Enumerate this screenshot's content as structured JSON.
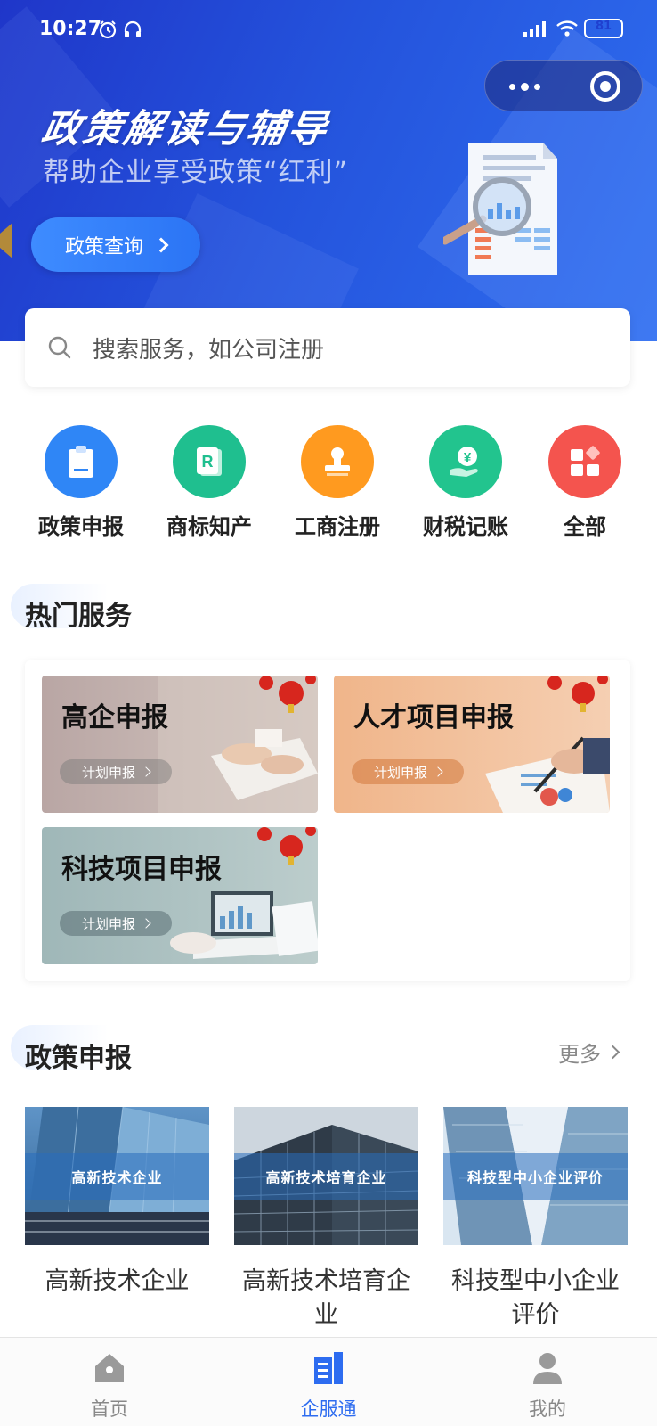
{
  "status_bar": {
    "time": "10:27",
    "battery": "81",
    "battery_level": 0.81
  },
  "banner": {
    "title": "政策解读与辅导",
    "subtitle": "帮助企业享受政策“红利”",
    "button_label": "政策查询"
  },
  "search": {
    "placeholder": "搜索服务，如公司注册"
  },
  "shortcuts": [
    {
      "label": "政策申报",
      "icon": "clipboard-icon",
      "color": "#2f86f6"
    },
    {
      "label": "商标知产",
      "icon": "trademark-icon",
      "color": "#1fbf8f"
    },
    {
      "label": "工商注册",
      "icon": "stamp-icon",
      "color": "#ff9a1f"
    },
    {
      "label": "财税记账",
      "icon": "yen-hand-icon",
      "color": "#22c48e"
    },
    {
      "label": "全部",
      "icon": "grid-icon",
      "color": "#f4544e"
    }
  ],
  "hot_services": {
    "title": "热门服务",
    "cards": [
      {
        "title": "高企申报",
        "button": "计划申报"
      },
      {
        "title": "人才项目申报",
        "button": "计划申报"
      },
      {
        "title": "科技项目申报",
        "button": "计划申报"
      }
    ]
  },
  "policy": {
    "title": "政策申报",
    "more": "更多",
    "items": [
      {
        "banner": "高新技术企业",
        "name": "高新技术企业"
      },
      {
        "banner": "高新技术培育企业",
        "name": "高新技术培育企业"
      },
      {
        "banner": "科技型中小企业评价",
        "name": "科技型中小企业评价"
      }
    ]
  },
  "tabbar": {
    "active_color": "#2d6cf0",
    "items": [
      {
        "label": "首页",
        "icon": "home-icon"
      },
      {
        "label": "企服通",
        "icon": "building-icon"
      },
      {
        "label": "我的",
        "icon": "user-icon"
      }
    ]
  }
}
